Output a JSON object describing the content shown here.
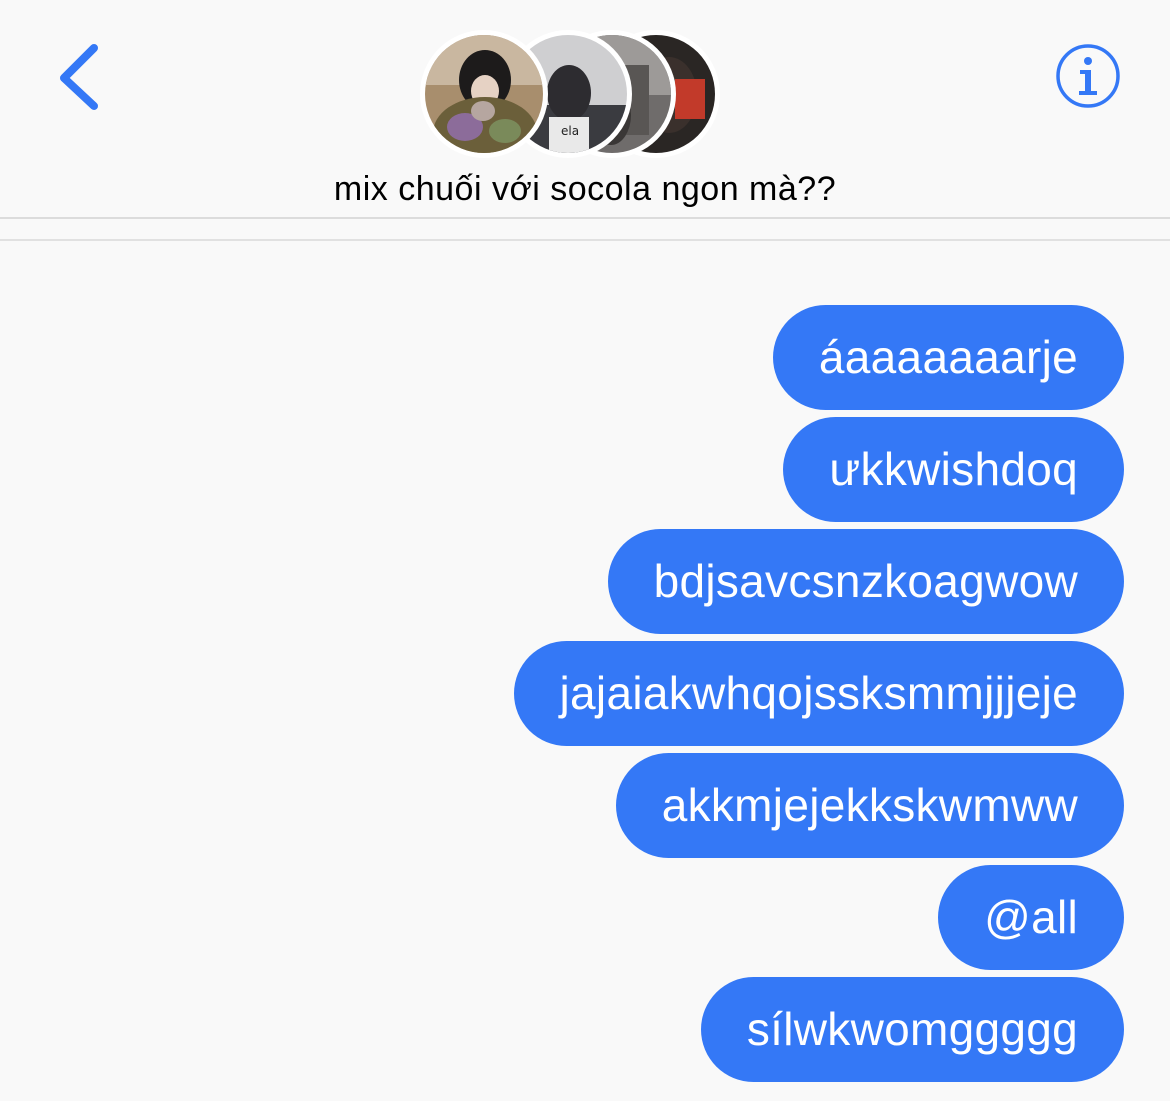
{
  "header": {
    "title": "mix chuối với socola ngon mà??",
    "back_icon": "chevron-left-icon",
    "info_icon": "info-circle-icon",
    "accent_color": "#3478f6"
  },
  "avatars": [
    {
      "name": "avatar-1"
    },
    {
      "name": "avatar-2"
    },
    {
      "name": "avatar-3"
    },
    {
      "name": "avatar-4"
    }
  ],
  "messages": [
    {
      "text": "áaaaaaaarje"
    },
    {
      "text": "ưkkwishdoq"
    },
    {
      "text": "bdjsavcsnzkoagwow"
    },
    {
      "text": "jajaiakwhqojssksmmjjjeje"
    },
    {
      "text": "akkmjejekkskwmww"
    },
    {
      "text": "@all"
    },
    {
      "text": "sílwkwomggggg"
    }
  ],
  "colors": {
    "bubble": "#3478f6",
    "bubble_text": "#ffffff",
    "background": "#f9f9f9"
  }
}
